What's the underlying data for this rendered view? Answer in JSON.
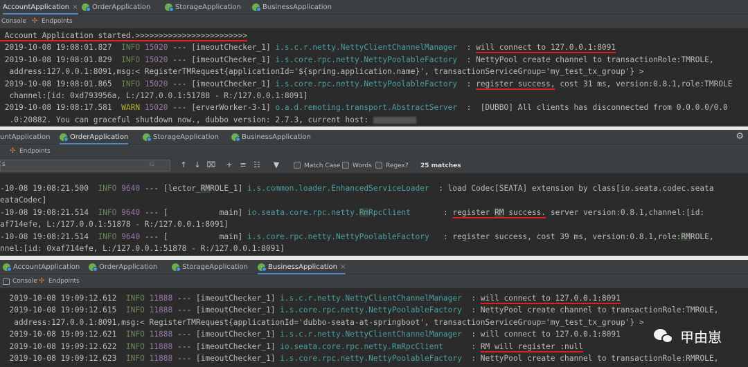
{
  "panels": [
    {
      "tabs": [
        {
          "label": "AccountApplication",
          "active": true,
          "close": "×"
        },
        {
          "label": "OrderApplication",
          "active": false,
          "close": ""
        },
        {
          "label": "StorageApplication",
          "active": false,
          "close": ""
        },
        {
          "label": "BusinessApplication",
          "active": false,
          "close": ""
        }
      ],
      "subtabs": {
        "console": "Console",
        "endpoints": "Endpoints"
      }
    },
    {
      "tabs": [
        {
          "label": "untApplication",
          "active": false,
          "close": ""
        },
        {
          "label": "OrderApplication",
          "active": true,
          "close": ""
        },
        {
          "label": "StorageApplication",
          "active": false,
          "close": ""
        },
        {
          "label": "BusinessApplication",
          "active": false,
          "close": ""
        }
      ],
      "subtabs": {
        "endpoints": "Endpoints"
      },
      "find": {
        "search_value": "s",
        "match_case": "Match Case",
        "words": "Words",
        "regex": "Regex",
        "regex_help": "?",
        "matches": "25 matches"
      }
    },
    {
      "tabs": [
        {
          "label": "AccountApplication",
          "active": false,
          "close": ""
        },
        {
          "label": "OrderApplication",
          "active": false,
          "close": ""
        },
        {
          "label": "StorageApplication",
          "active": false,
          "close": ""
        },
        {
          "label": "BusinessApplication",
          "active": true,
          "close": "×"
        }
      ],
      "subtabs": {
        "console": "Console",
        "endpoints": "Endpoints"
      }
    }
  ],
  "console1": [
    [
      {
        "t": " Account Application started.>>>>>>>>>>>>>>>>>>>>>>>>",
        "c": "t-def",
        "u": true
      }
    ],
    [
      {
        "t": " 2019-10-08 19:08:01.827  ",
        "c": "t-def"
      },
      {
        "t": "INFO",
        "c": "t-info"
      },
      {
        "t": " ",
        "c": "t-def"
      },
      {
        "t": "15020",
        "c": "t-pid"
      },
      {
        "t": " --- [imeoutChecker_1] ",
        "c": "t-def"
      },
      {
        "t": "i.s.c.r.netty.NettyClientChannelManager",
        "c": "t-cls"
      },
      {
        "t": "  : ",
        "c": "t-def"
      },
      {
        "t": "will connect to 127.0.0.1:8091",
        "c": "t-def",
        "u": true
      }
    ],
    [
      {
        "t": " 2019-10-08 19:08:01.829  ",
        "c": "t-def"
      },
      {
        "t": "INFO",
        "c": "t-info"
      },
      {
        "t": " ",
        "c": "t-def"
      },
      {
        "t": "15020",
        "c": "t-pid"
      },
      {
        "t": " --- [imeoutChecker_1] ",
        "c": "t-def"
      },
      {
        "t": "i.s.core.rpc.netty.NettyPoolableFactory",
        "c": "t-cls"
      },
      {
        "t": "  : NettyPool create channel to transactionRole:TMROLE,",
        "c": "t-def"
      }
    ],
    [
      {
        "t": "  address:127.0.0.1:8091,msg:< RegisterTMRequest{applicationId='${spring.application.name}', transactionServiceGroup='my_test_tx_group'} >",
        "c": "t-def"
      }
    ],
    [
      {
        "t": " 2019-10-08 19:08:01.865  ",
        "c": "t-def"
      },
      {
        "t": "INFO",
        "c": "t-info"
      },
      {
        "t": " ",
        "c": "t-def"
      },
      {
        "t": "15020",
        "c": "t-pid"
      },
      {
        "t": " --- [imeoutChecker_1] ",
        "c": "t-def"
      },
      {
        "t": "i.s.core.rpc.netty.NettyPoolableFactory",
        "c": "t-cls"
      },
      {
        "t": "  : ",
        "c": "t-def"
      },
      {
        "t": "register success,",
        "c": "t-def",
        "u": true
      },
      {
        "t": " cost 31 ms, version:0.8.1,role:TMROLE",
        "c": "t-def"
      }
    ],
    [
      {
        "t": "  channel:[id: 0xd793956a, L:/127.0.0.1:51788 - R:/127.0.0.1:8091]",
        "c": "t-def"
      }
    ],
    [
      {
        "t": " 2019-10-08 19:08:17.581  ",
        "c": "t-def"
      },
      {
        "t": "WARN",
        "c": "t-warn"
      },
      {
        "t": " ",
        "c": "t-def"
      },
      {
        "t": "15020",
        "c": "t-pid"
      },
      {
        "t": " --- [erverWorker-3-1] ",
        "c": "t-def"
      },
      {
        "t": "o.a.d.remoting.transport.AbstractServer",
        "c": "t-cls"
      },
      {
        "t": "  :  [DUBBO] All clients has disconnected from 0.0.0.0/0.0",
        "c": "t-def"
      }
    ],
    [
      {
        "t": "  .0:20882. You can graceful shutdown now., dubbo version: 2.7.3, current host: ",
        "c": "t-def"
      },
      {
        "t": "",
        "c": "blur"
      }
    ]
  ],
  "console2": [
    [
      {
        "t": "-10-08 19:08:21.500  ",
        "c": "t-def"
      },
      {
        "t": "INFO",
        "c": "t-info"
      },
      {
        "t": " ",
        "c": "t-def"
      },
      {
        "t": "9640",
        "c": "t-pid"
      },
      {
        "t": " --- [lector_",
        "c": "t-def"
      },
      {
        "t": "RM",
        "c": "t-def",
        "h": true
      },
      {
        "t": "ROLE_1] ",
        "c": "t-def"
      },
      {
        "t": "i.s.common.loader.EnhancedServiceLoader",
        "c": "t-cls"
      },
      {
        "t": "  : load Codec[SEATA] extension by class[io.seata.codec.seata",
        "c": "t-def"
      }
    ],
    [
      {
        "t": "eataCodec]",
        "c": "t-def"
      }
    ],
    [
      {
        "t": "-10-08 19:08:21.514  ",
        "c": "t-def"
      },
      {
        "t": "INFO",
        "c": "t-info"
      },
      {
        "t": " ",
        "c": "t-def"
      },
      {
        "t": "9640",
        "c": "t-pid"
      },
      {
        "t": " --- [           main] ",
        "c": "t-def"
      },
      {
        "t": "io.seata.core.rpc.netty.",
        "c": "t-cls"
      },
      {
        "t": "Rm",
        "c": "t-cls",
        "h": true
      },
      {
        "t": "RpcClient",
        "c": "t-cls"
      },
      {
        "t": "       : ",
        "c": "t-def"
      },
      {
        "t": "register ",
        "c": "t-def",
        "u": true
      },
      {
        "t": "RM",
        "c": "t-def",
        "u": true,
        "h": true
      },
      {
        "t": " success.",
        "c": "t-def",
        "u": true
      },
      {
        "t": " server version:0.8.1,channel:[id:",
        "c": "t-def"
      }
    ],
    [
      {
        "t": "af714efe, L:/127.0.0.1:51878 - R:/127.0.0.1:8091]",
        "c": "t-def"
      }
    ],
    [
      {
        "t": "-10-08 19:08:21.514  ",
        "c": "t-def"
      },
      {
        "t": "INFO",
        "c": "t-info"
      },
      {
        "t": " ",
        "c": "t-def"
      },
      {
        "t": "9640",
        "c": "t-pid"
      },
      {
        "t": " --- [           main] ",
        "c": "t-def"
      },
      {
        "t": "i.s.core.rpc.netty.NettyPoolableFactory",
        "c": "t-cls"
      },
      {
        "t": "   : register success, cost 39 ms, version:0.8.1,role:",
        "c": "t-def"
      },
      {
        "t": "RM",
        "c": "t-def",
        "h": true
      },
      {
        "t": "ROLE,",
        "c": "t-def"
      }
    ],
    [
      {
        "t": "nnel:[id: 0xaf714efe, L:/127.0.0.1:51878 - R:/127.0.0.1:8091]",
        "c": "t-def"
      }
    ]
  ],
  "console3": [
    [
      {
        "t": "  2019-10-08 19:09:12.612  ",
        "c": "t-def"
      },
      {
        "t": "INFO",
        "c": "t-info"
      },
      {
        "t": " ",
        "c": "t-def"
      },
      {
        "t": "11888",
        "c": "t-pid"
      },
      {
        "t": " --- [imeoutChecker_1] ",
        "c": "t-def"
      },
      {
        "t": "i.s.c.r.netty.NettyClientChannelManager",
        "c": "t-cls"
      },
      {
        "t": "  : ",
        "c": "t-def"
      },
      {
        "t": "will connect to 127.0.0.1:8091",
        "c": "t-def",
        "u": true
      }
    ],
    [
      {
        "t": "  2019-10-08 19:09:12.615  ",
        "c": "t-def"
      },
      {
        "t": "INFO",
        "c": "t-info"
      },
      {
        "t": " ",
        "c": "t-def"
      },
      {
        "t": "11888",
        "c": "t-pid"
      },
      {
        "t": " --- [imeoutChecker_1] ",
        "c": "t-def"
      },
      {
        "t": "i.s.core.rpc.netty.NettyPoolableFactory",
        "c": "t-cls"
      },
      {
        "t": "  : NettyPool create channel to transactionRole:TMROLE,",
        "c": "t-def"
      }
    ],
    [
      {
        "t": "   address:127.0.0.1:8091,msg:< RegisterTMRequest{applicationId='dubbo-seata-at-springboot', transactionServiceGroup='my_test_tx_group'} >",
        "c": "t-def"
      }
    ],
    [
      {
        "t": "  2019-10-08 19:09:12.621  ",
        "c": "t-def"
      },
      {
        "t": "INFO",
        "c": "t-info"
      },
      {
        "t": " ",
        "c": "t-def"
      },
      {
        "t": "11888",
        "c": "t-pid"
      },
      {
        "t": " --- [imeoutChecker_1] ",
        "c": "t-def"
      },
      {
        "t": "i.s.c.r.netty.NettyClientChannelManager",
        "c": "t-cls"
      },
      {
        "t": "  : will connect to 127.0.0.1:8091",
        "c": "t-def"
      }
    ],
    [
      {
        "t": "  2019-10-08 19:09:12.622  ",
        "c": "t-def"
      },
      {
        "t": "INFO",
        "c": "t-info"
      },
      {
        "t": " ",
        "c": "t-def"
      },
      {
        "t": "11888",
        "c": "t-pid"
      },
      {
        "t": " --- [imeoutChecker_1] ",
        "c": "t-def"
      },
      {
        "t": "io.seata.core.rpc.netty.RmRpcClient",
        "c": "t-cls"
      },
      {
        "t": "      : ",
        "c": "t-def"
      },
      {
        "t": "RM will register :null",
        "c": "t-def",
        "u": true
      }
    ],
    [
      {
        "t": "  2019-10-08 19:09:12.623  ",
        "c": "t-def"
      },
      {
        "t": "INFO",
        "c": "t-info"
      },
      {
        "t": " ",
        "c": "t-def"
      },
      {
        "t": "11888",
        "c": "t-pid"
      },
      {
        "t": " --- [imeoutChecker_1] ",
        "c": "t-def"
      },
      {
        "t": "i.s.core.rpc.netty.NettyPoolableFactory",
        "c": "t-cls"
      },
      {
        "t": "  : NettyPool create channel to transactionRole:RMROLE,",
        "c": "t-def"
      }
    ]
  ],
  "watermark": {
    "text": "甲由崽",
    "icon": "wechat-icon"
  },
  "colors": {
    "accent_tab": "#4a88c7",
    "underline": "#e02020",
    "info": "#6a8759",
    "warn": "#bbb529"
  }
}
